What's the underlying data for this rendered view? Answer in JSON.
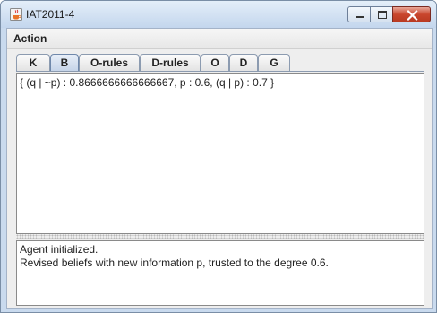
{
  "window": {
    "title": "IAT2011-4",
    "app_icon": "java-cup-icon",
    "controls": [
      "minimize-icon",
      "maximize-icon",
      "close-icon"
    ]
  },
  "menubar": {
    "items": [
      {
        "label": "Action"
      }
    ]
  },
  "tabs": [
    {
      "label": "K",
      "selected": false
    },
    {
      "label": "B",
      "selected": true
    },
    {
      "label": "O-rules",
      "selected": false
    },
    {
      "label": "D-rules",
      "selected": false
    },
    {
      "label": "O",
      "selected": false
    },
    {
      "label": "D",
      "selected": false
    },
    {
      "label": "G",
      "selected": false
    }
  ],
  "belief_panel": {
    "text": "{ (q | ~p) : 0.8666666666666667, p : 0.6, (q | p) : 0.7 }"
  },
  "log_panel": {
    "lines": [
      "Agent initialized.",
      "Revised beliefs with new information p, trusted to the degree 0.6."
    ]
  },
  "colors": {
    "titlebar": "#c9daee",
    "selected_tab": "#c4d3e8",
    "close_button": "#c9462d"
  }
}
